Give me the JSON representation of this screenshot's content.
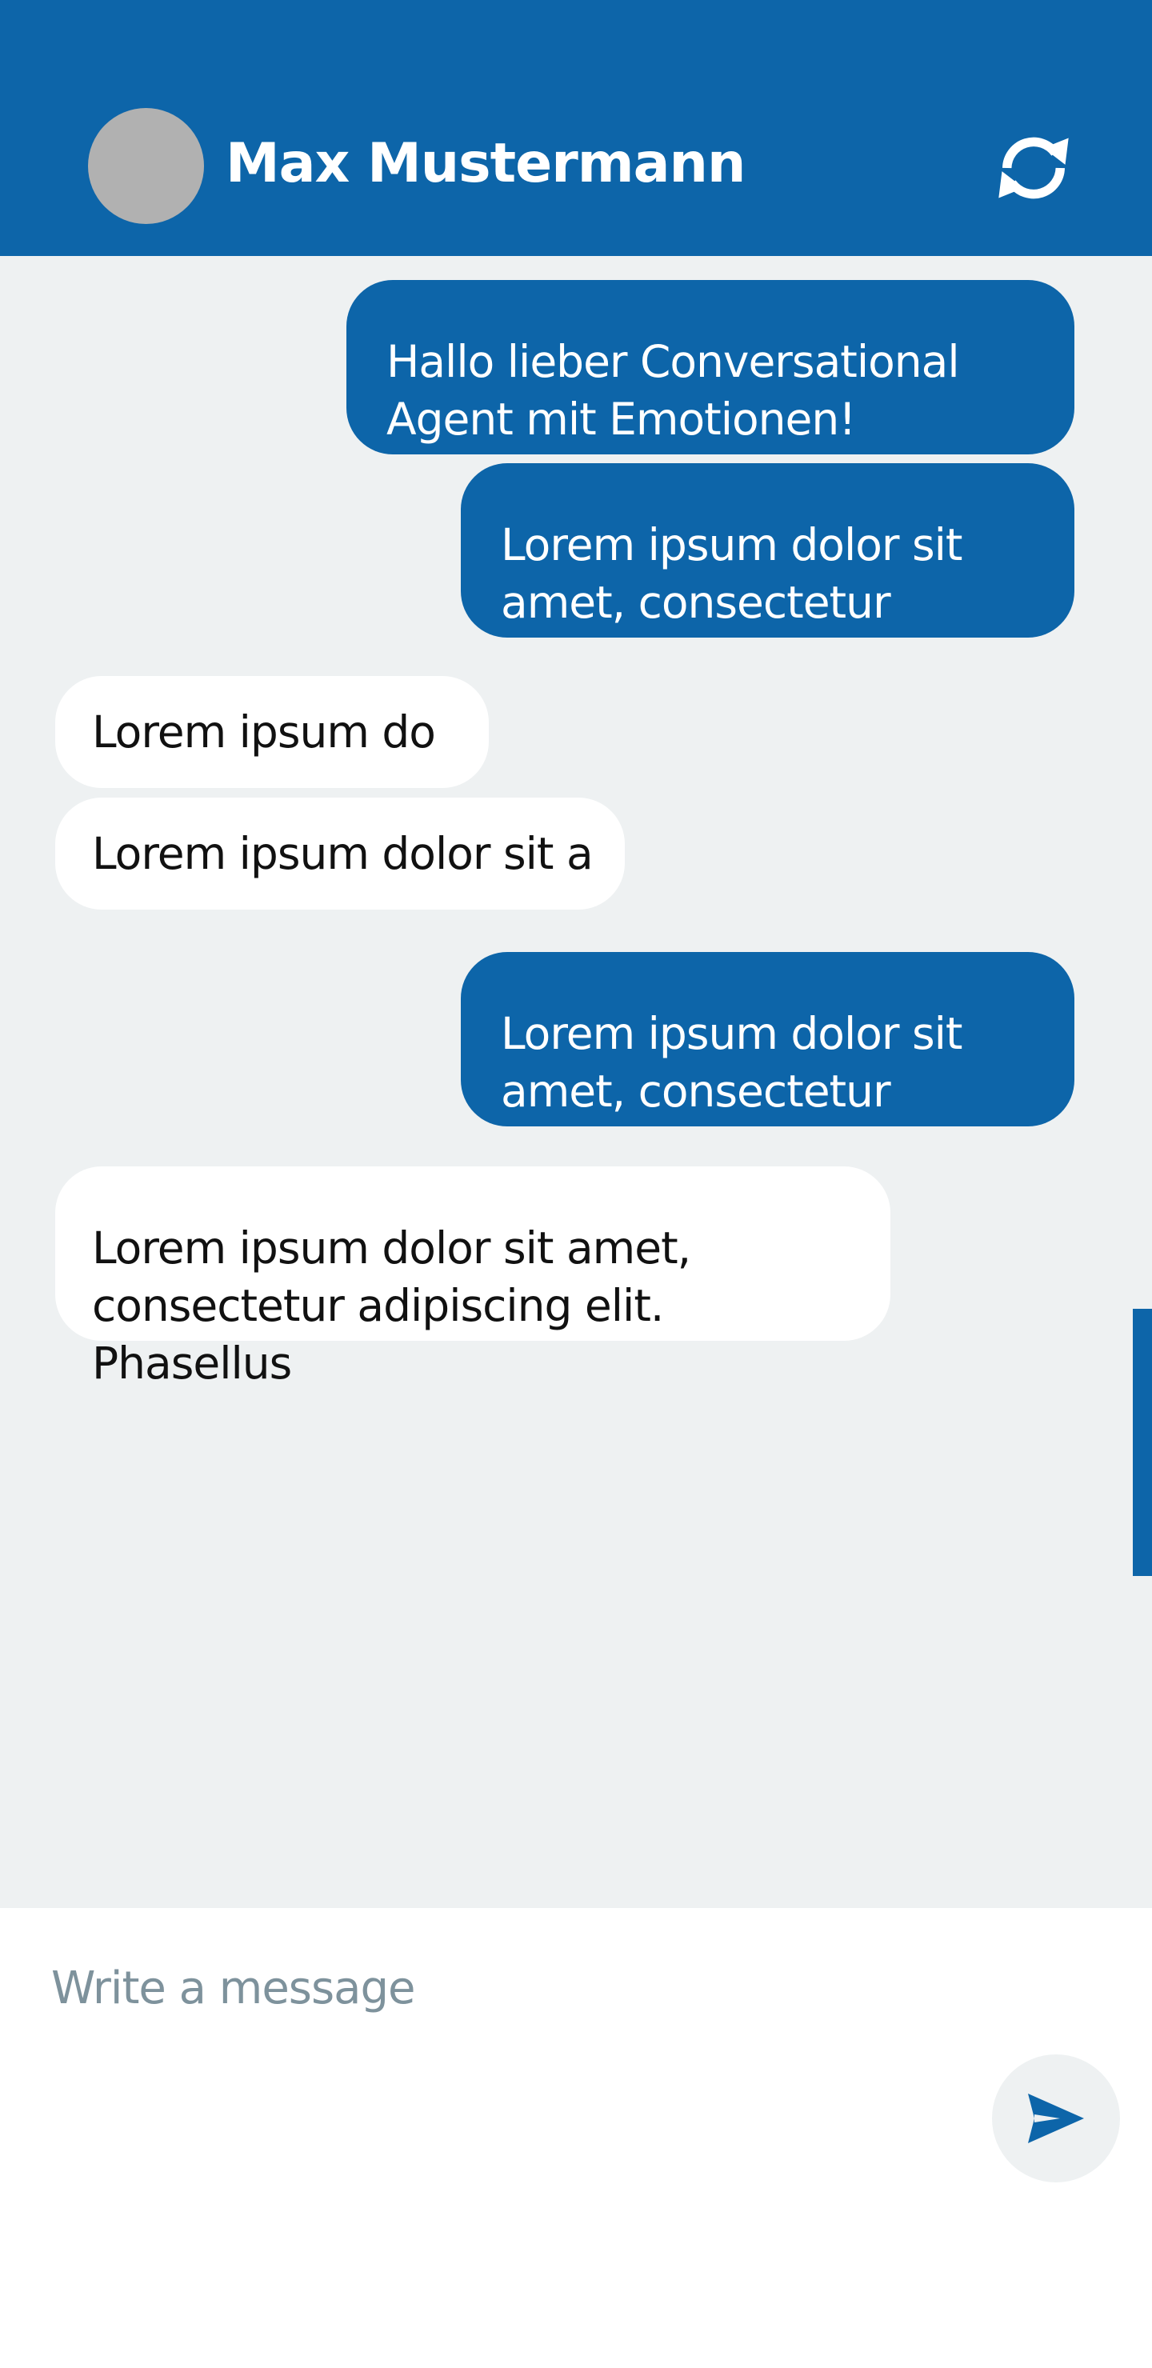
{
  "header": {
    "contact_name": "Max Mustermann",
    "refresh_icon": "refresh-icon"
  },
  "colors": {
    "brand": "#0d65a9",
    "background": "#eef1f2",
    "incoming_bubble": "#ffffff",
    "avatar_placeholder": "#b1b1b1",
    "placeholder_text": "#7e929c"
  },
  "messages": [
    {
      "direction": "outgoing",
      "text": "Hallo lieber Conversational Agent mit Emotionen!"
    },
    {
      "direction": "outgoing",
      "text": "Lorem ipsum dolor sit amet, consectetur"
    },
    {
      "direction": "incoming",
      "text": "Lorem ipsum do"
    },
    {
      "direction": "incoming",
      "text": "Lorem ipsum dolor sit a"
    },
    {
      "direction": "outgoing",
      "text": "Lorem ipsum dolor sit amet, consectetur"
    },
    {
      "direction": "incoming",
      "text": "Lorem ipsum dolor sit amet, consectetur adipiscing elit. Phasellus"
    }
  ],
  "composer": {
    "placeholder": "Write a message",
    "value": "",
    "send_icon": "send-icon"
  }
}
